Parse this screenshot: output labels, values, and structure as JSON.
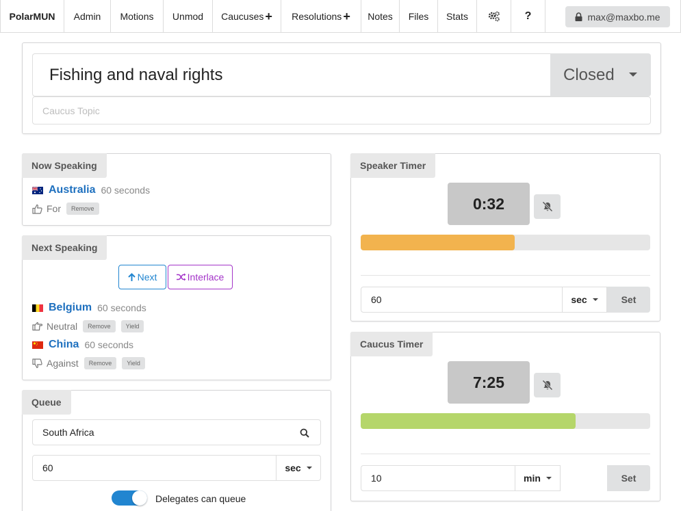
{
  "nav": {
    "brand": "PolarMUN",
    "items": [
      {
        "label": "Admin"
      },
      {
        "label": "Motions"
      },
      {
        "label": "Unmod"
      },
      {
        "label": "Caucuses",
        "plus": true
      },
      {
        "label": "Resolutions",
        "plus": true
      },
      {
        "label": "Notes"
      },
      {
        "label": "Files"
      },
      {
        "label": "Stats"
      }
    ],
    "settings_icon": "cogs-icon",
    "help_label": "?",
    "user": "max@maxbo.me"
  },
  "caucus": {
    "name": "Fishing and naval rights",
    "status": "Closed",
    "topic_placeholder": "Caucus Topic"
  },
  "now_speaking": {
    "label": "Now Speaking",
    "country": "Australia",
    "duration": "60 seconds",
    "stance": "For",
    "remove_label": "Remove"
  },
  "next_speaking": {
    "label": "Next Speaking",
    "next_label": "Next",
    "interlace_label": "Interlace",
    "speakers": [
      {
        "country": "Belgium",
        "duration": "60 seconds",
        "stance": "Neutral",
        "remove_label": "Remove",
        "yield_label": "Yield"
      },
      {
        "country": "China",
        "duration": "60 seconds",
        "stance": "Against",
        "remove_label": "Remove",
        "yield_label": "Yield"
      }
    ]
  },
  "queue": {
    "label": "Queue",
    "country_value": "South Africa",
    "duration_value": "60",
    "unit": "sec",
    "toggle_label": "Delegates can queue",
    "toggle_on": true
  },
  "speaker_timer": {
    "label": "Speaker Timer",
    "time": "0:32",
    "progress_fraction": 0.533,
    "bar_color": "#f2b34e",
    "input_value": "60",
    "unit": "sec",
    "set_label": "Set"
  },
  "caucus_timer": {
    "label": "Caucus Timer",
    "time": "7:25",
    "progress_fraction": 0.742,
    "bar_color": "#b5d66a",
    "input_value": "10",
    "unit": "min",
    "set_label": "Set"
  },
  "colors": {
    "link": "#1e70bf",
    "primary": "#2185d0",
    "purple": "#a333c8"
  }
}
